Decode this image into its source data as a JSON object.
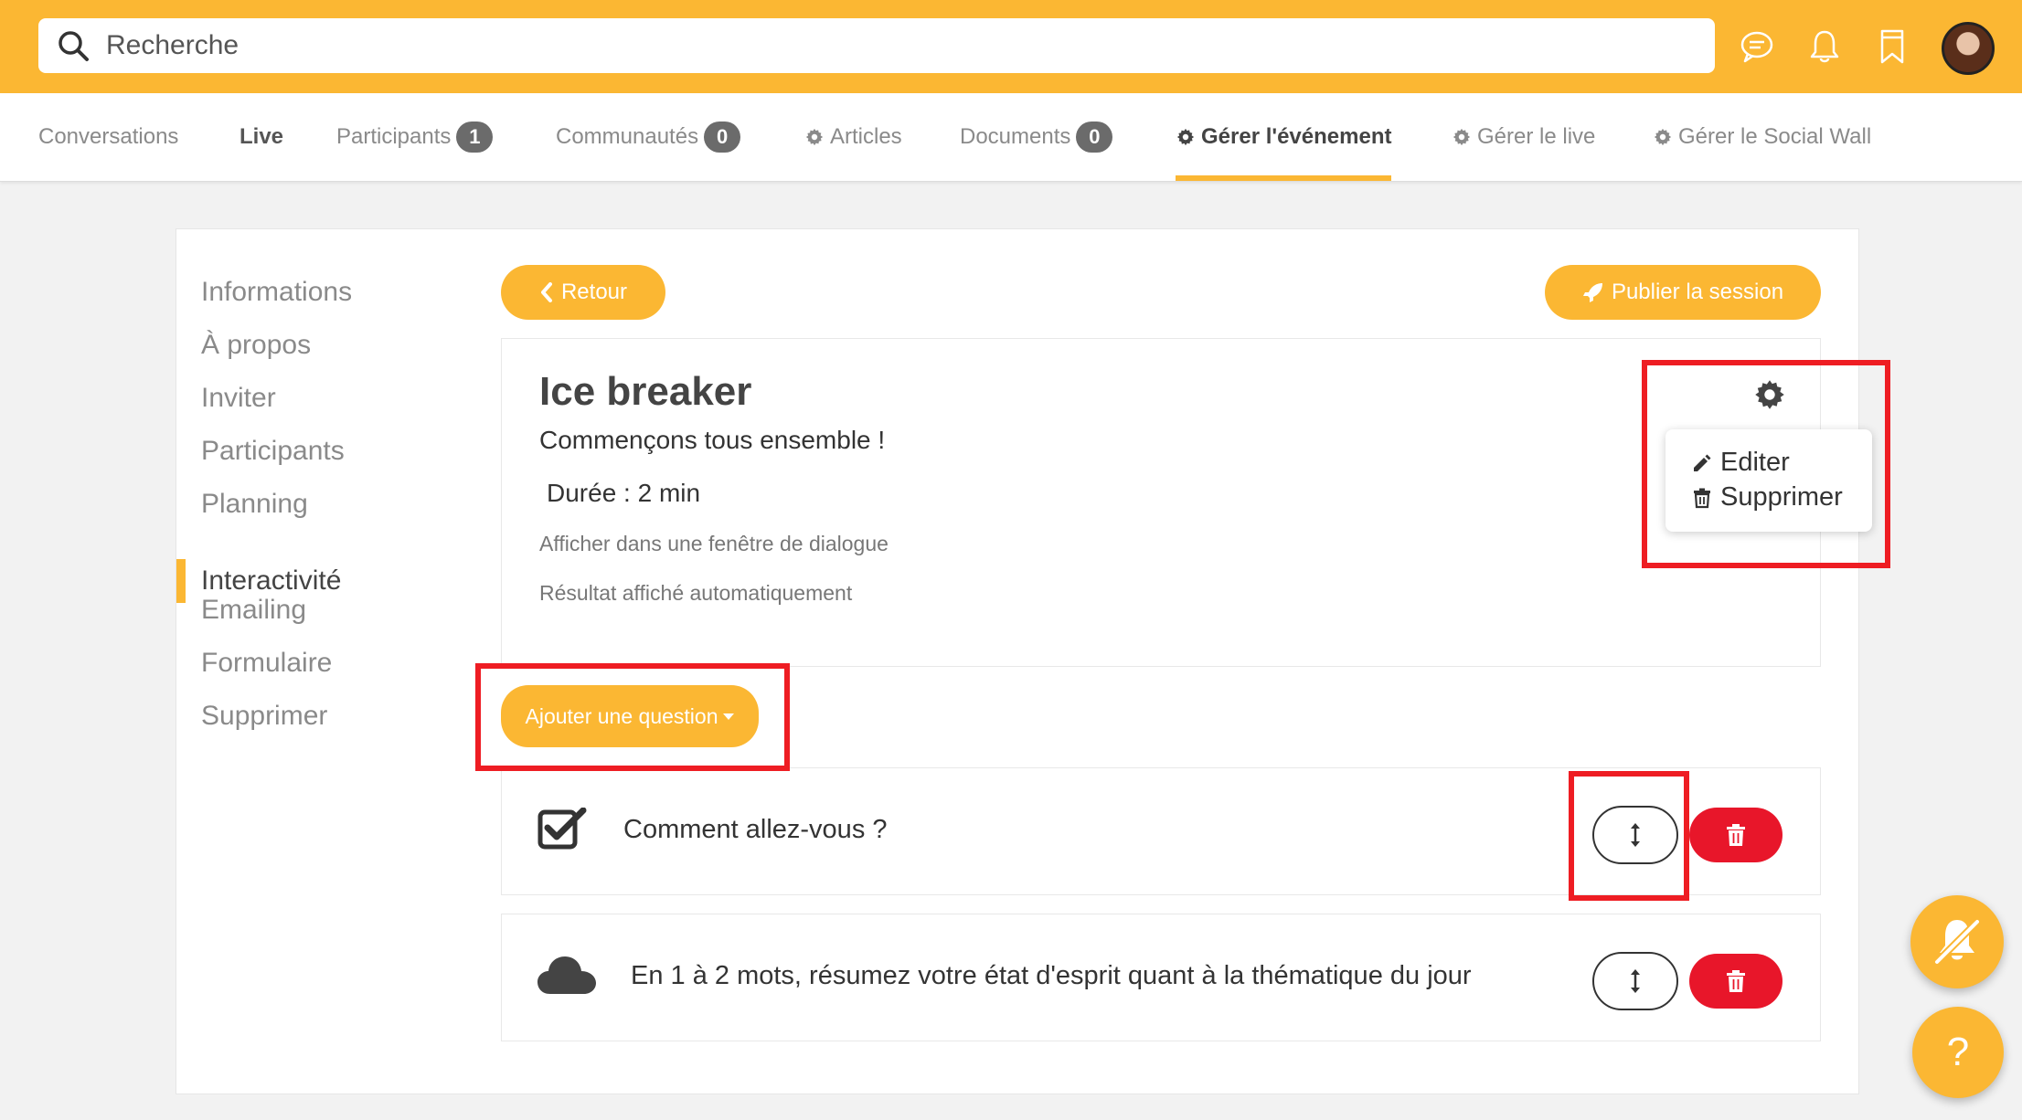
{
  "search": {
    "placeholder": "Recherche"
  },
  "topbar_icons": [
    "chat-icon",
    "bell-icon",
    "bookmark-icon"
  ],
  "nav": {
    "tabs": [
      {
        "label": "Conversations"
      },
      {
        "label": "Live"
      },
      {
        "label": "Participants",
        "badge": "1"
      },
      {
        "label": "Communautés",
        "badge": "0"
      },
      {
        "label": "Articles"
      },
      {
        "label": "Documents",
        "badge": "0"
      },
      {
        "label": "Gérer l'événement"
      },
      {
        "label": "Gérer le live"
      },
      {
        "label": "Gérer le Social Wall"
      }
    ]
  },
  "sidebar": {
    "items": [
      {
        "label": "Informations"
      },
      {
        "label": "À propos"
      },
      {
        "label": "Inviter"
      },
      {
        "label": "Participants"
      },
      {
        "label": "Planning"
      },
      {
        "label": "Interactivité"
      },
      {
        "label": "Emailing"
      },
      {
        "label": "Formulaire"
      },
      {
        "label": "Supprimer"
      }
    ]
  },
  "actions": {
    "back_label": "Retour",
    "publish_label": "Publier la session",
    "add_question_label": "Ajouter une question"
  },
  "session": {
    "title": "Ice breaker",
    "subtitle": "Commençons tous ensemble !",
    "duration": "Durée : 2 min",
    "option_dialog": "Afficher dans une fenêtre de dialogue",
    "option_result": "Résultat affiché automatiquement"
  },
  "menu": {
    "edit_label": "Editer",
    "delete_label": "Supprimer"
  },
  "questions": [
    {
      "text": "Comment allez-vous ?",
      "icon": "checkbox-icon"
    },
    {
      "text": "En 1 à 2 mots, résumez votre état d'esprit quant à la thématique du jour",
      "icon": "cloud-icon"
    }
  ],
  "fabs": {
    "help_label": "?"
  },
  "colors": {
    "accent": "#fbb733",
    "danger": "#e8162a",
    "highlight": "#ee1d23"
  }
}
